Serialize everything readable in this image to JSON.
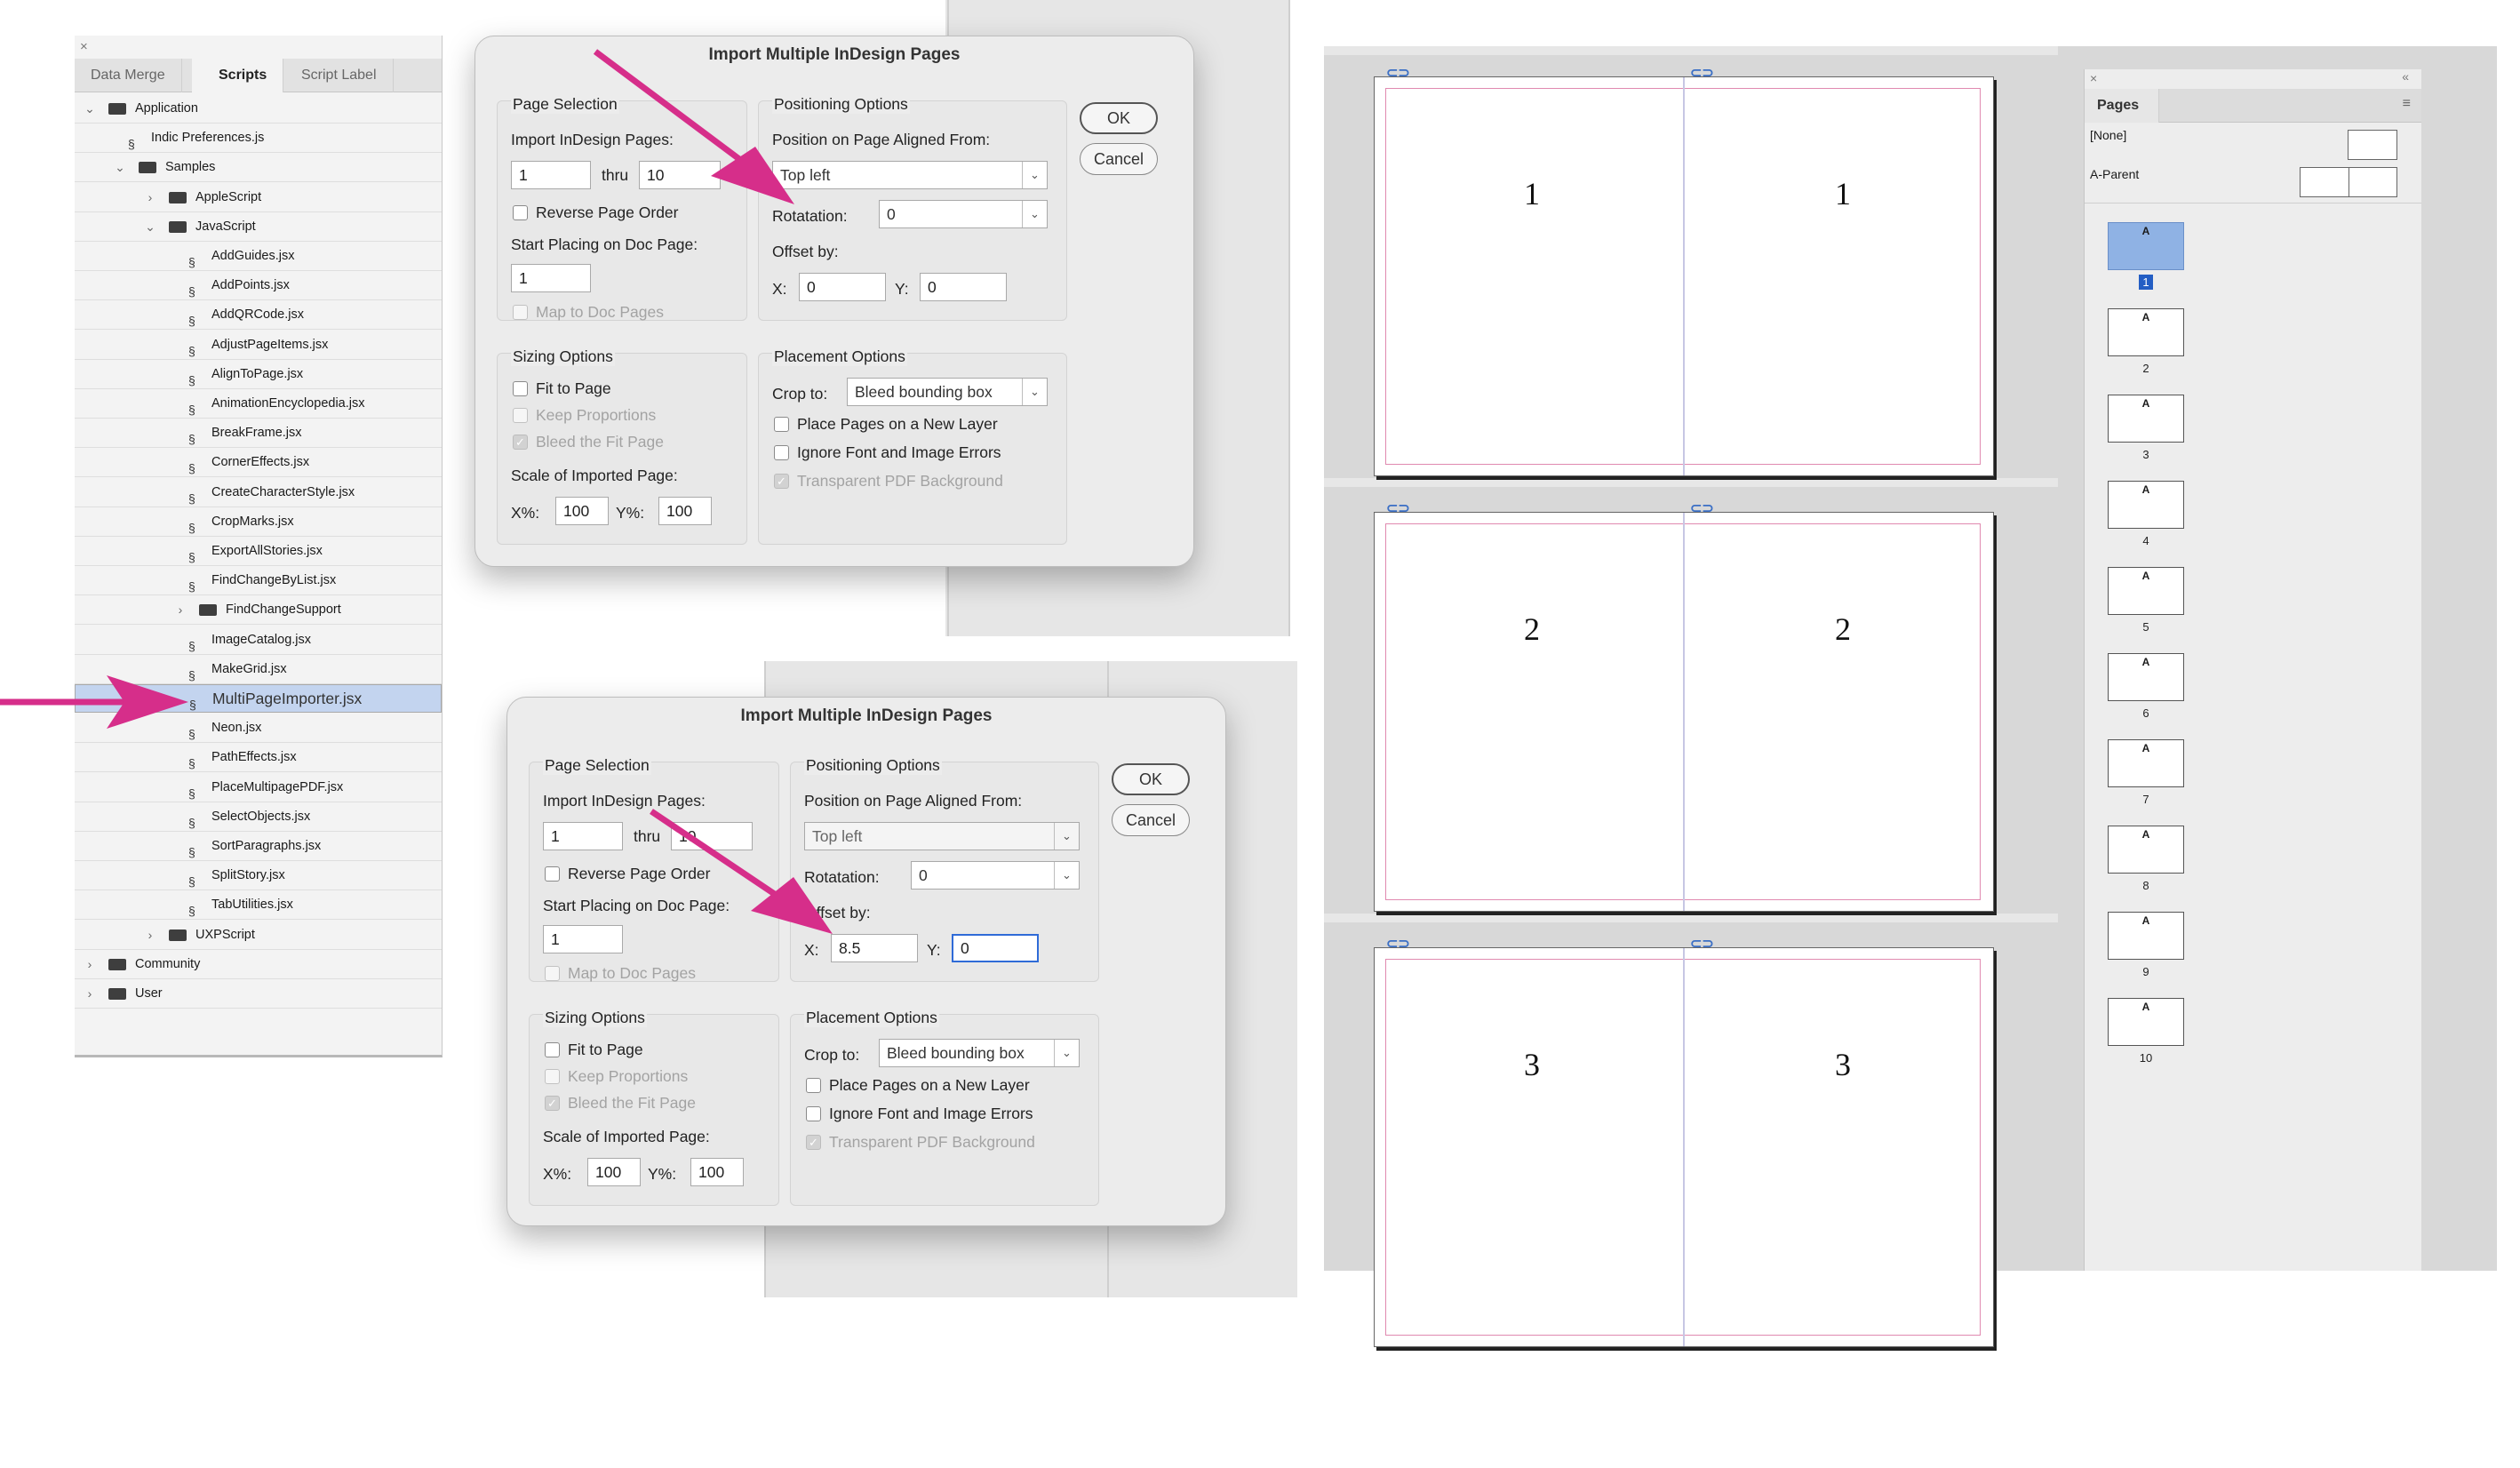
{
  "scripts_panel": {
    "tabs": [
      "Data Merge",
      "Scripts",
      "Script Label"
    ],
    "tree": [
      {
        "label": "Application",
        "type": "folder",
        "expanded": true
      },
      {
        "label": "Indic Preferences.js",
        "type": "script"
      },
      {
        "label": "Samples",
        "type": "folder",
        "expanded": true
      },
      {
        "label": "AppleScript",
        "type": "folder",
        "expanded": false
      },
      {
        "label": "JavaScript",
        "type": "folder",
        "expanded": true
      },
      {
        "label": "AddGuides.jsx",
        "type": "script"
      },
      {
        "label": "AddPoints.jsx",
        "type": "script"
      },
      {
        "label": "AddQRCode.jsx",
        "type": "script"
      },
      {
        "label": "AdjustPageItems.jsx",
        "type": "script"
      },
      {
        "label": "AlignToPage.jsx",
        "type": "script"
      },
      {
        "label": "AnimationEncyclopedia.jsx",
        "type": "script"
      },
      {
        "label": "BreakFrame.jsx",
        "type": "script"
      },
      {
        "label": "CornerEffects.jsx",
        "type": "script"
      },
      {
        "label": "CreateCharacterStyle.jsx",
        "type": "script"
      },
      {
        "label": "CropMarks.jsx",
        "type": "script"
      },
      {
        "label": "ExportAllStories.jsx",
        "type": "script"
      },
      {
        "label": "FindChangeByList.jsx",
        "type": "script"
      },
      {
        "label": "FindChangeSupport",
        "type": "folder",
        "expanded": false
      },
      {
        "label": "ImageCatalog.jsx",
        "type": "script"
      },
      {
        "label": "MakeGrid.jsx",
        "type": "script"
      },
      {
        "label": "MultiPageImporter.jsx",
        "type": "script",
        "selected": true
      },
      {
        "label": "Neon.jsx",
        "type": "script"
      },
      {
        "label": "PathEffects.jsx",
        "type": "script"
      },
      {
        "label": "PlaceMultipagePDF.jsx",
        "type": "script"
      },
      {
        "label": "SelectObjects.jsx",
        "type": "script"
      },
      {
        "label": "SortParagraphs.jsx",
        "type": "script"
      },
      {
        "label": "SplitStory.jsx",
        "type": "script"
      },
      {
        "label": "TabUtilities.jsx",
        "type": "script"
      },
      {
        "label": "UXPScript",
        "type": "folder",
        "expanded": false
      },
      {
        "label": "Community",
        "type": "folder",
        "expanded": false
      },
      {
        "label": "User",
        "type": "folder",
        "expanded": false
      }
    ]
  },
  "dialog_common": {
    "title": "Import Multiple InDesign Pages",
    "ok": "OK",
    "cancel": "Cancel",
    "page_selection": "Page Selection",
    "import_pages": "Import InDesign Pages:",
    "thru": "thru",
    "reverse": "Reverse Page Order",
    "start_placing": "Start Placing on Doc Page:",
    "map_to_doc": "Map to Doc Pages",
    "sizing_options": "Sizing Options",
    "fit_to_page": "Fit to Page",
    "keep_proportions": "Keep Proportions",
    "bleed_fit": "Bleed the Fit Page",
    "scale_imported": "Scale of Imported Page:",
    "x_pct": "X%:",
    "y_pct": "Y%:",
    "positioning_options": "Positioning Options",
    "position_aligned": "Position on Page Aligned From:",
    "rotatation": "Rotatation:",
    "offset_by": "Offset by:",
    "x": "X:",
    "y": "Y:",
    "placement_options": "Placement Options",
    "crop_to": "Crop to:",
    "place_new_layer": "Place Pages on a New Layer",
    "ignore_font": "Ignore Font and Image Errors",
    "transparent_bg": "Transparent PDF Background"
  },
  "dialog1": {
    "from": "1",
    "to": "10",
    "start": "1",
    "scale_x": "100",
    "scale_y": "100",
    "position": "Top left",
    "rotation": "0",
    "offset_x": "0",
    "offset_y": "0",
    "crop": "Bleed bounding box"
  },
  "dialog2": {
    "from": "1",
    "to": "10",
    "start": "1",
    "scale_x": "100",
    "scale_y": "100",
    "position": "Top left",
    "rotation": "0",
    "offset_x": "8.5",
    "offset_y": "0",
    "crop": "Bleed bounding box"
  },
  "spreads": [
    {
      "left": "1",
      "right": "1"
    },
    {
      "left": "2",
      "right": "2"
    },
    {
      "left": "3",
      "right": "3"
    }
  ],
  "pages_panel": {
    "title": "Pages",
    "none": "[None]",
    "a_parent": "A-Parent",
    "master_letter": "A",
    "pages": [
      "1",
      "2",
      "3",
      "4",
      "5",
      "6",
      "7",
      "8",
      "9",
      "10"
    ],
    "selected_page": "1"
  },
  "colors": {
    "arrow": "#d62e8a",
    "selection": "#c3d4ef",
    "focus": "#2f6bd7"
  }
}
